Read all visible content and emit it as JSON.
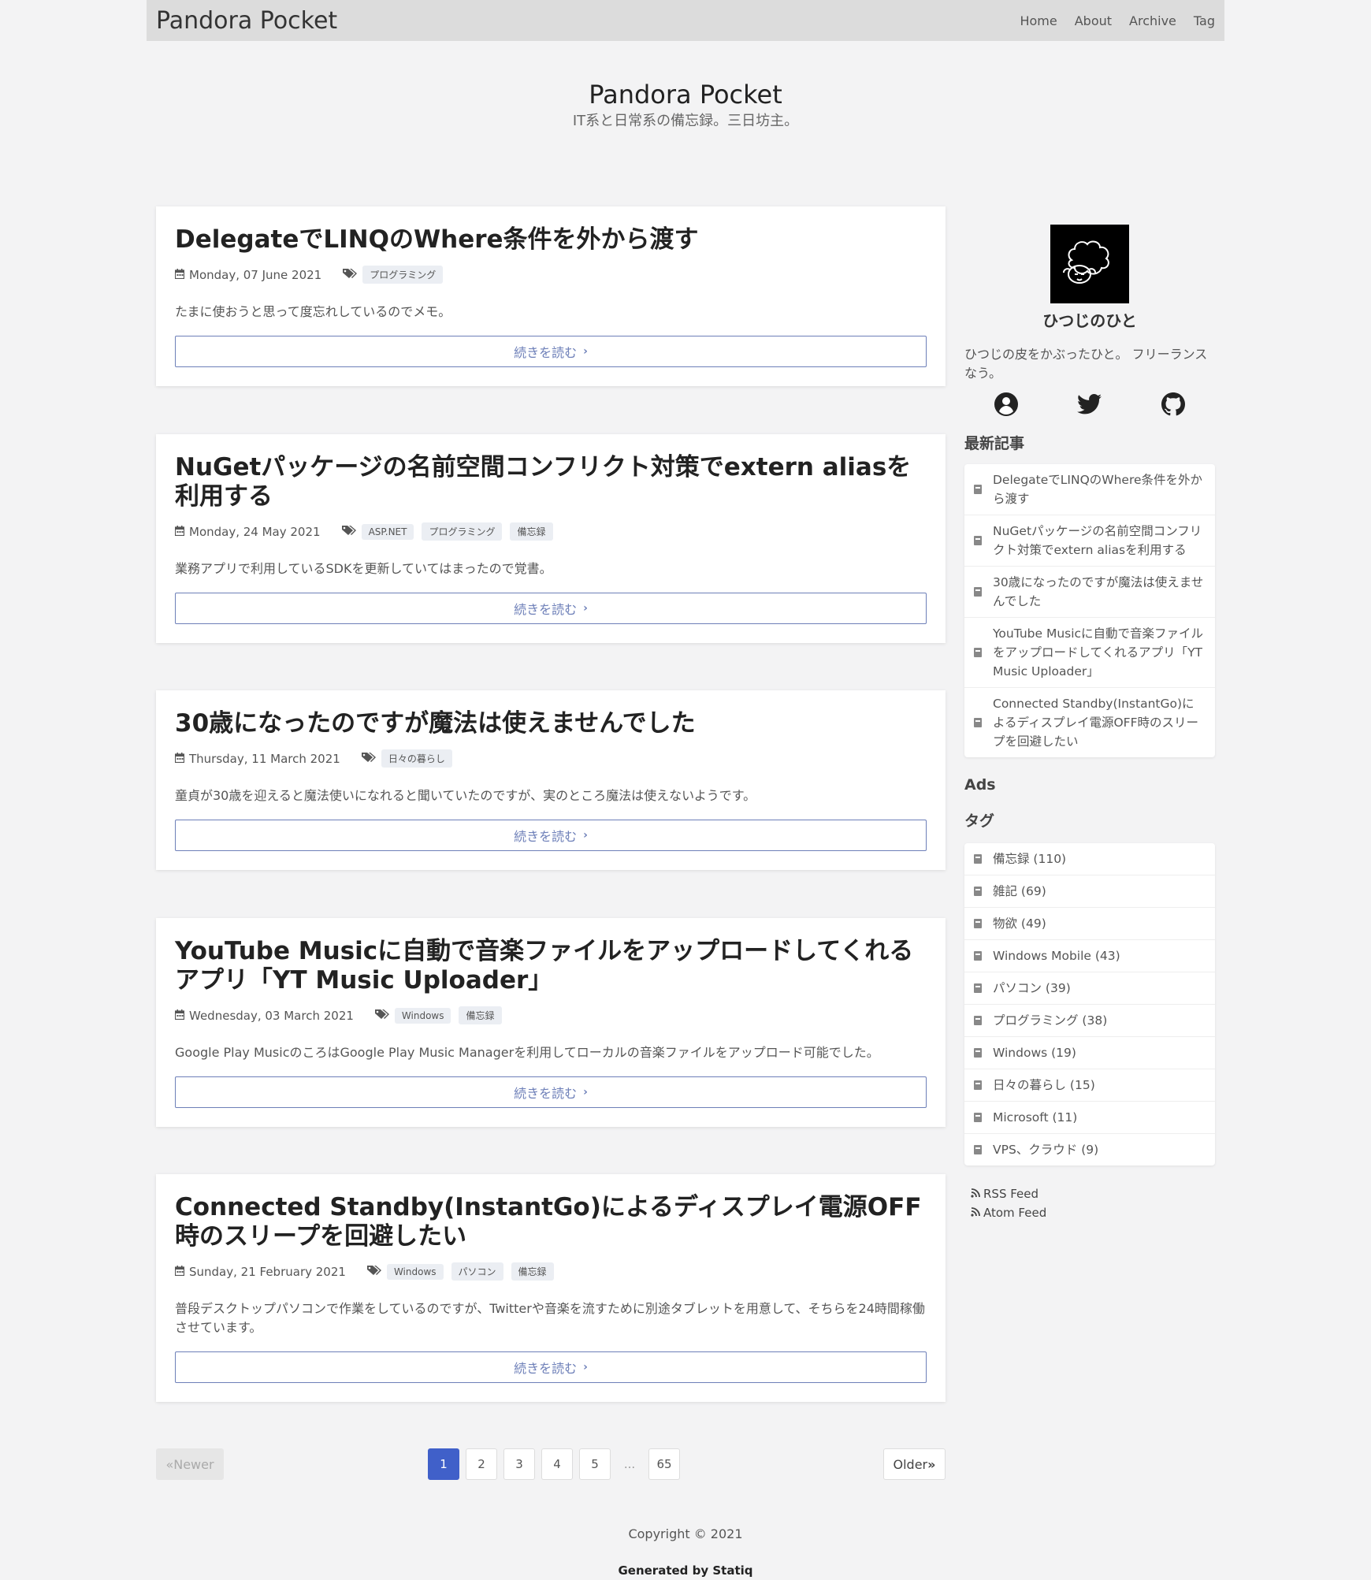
{
  "navbar": {
    "brand": "Pandora Pocket",
    "links": [
      "Home",
      "About",
      "Archive",
      "Tag"
    ]
  },
  "hero": {
    "title": "Pandora Pocket",
    "subtitle": "IT系と日常系の備忘録。三日坊主。"
  },
  "read_more_label": "続きを読む",
  "posts": [
    {
      "title": "DelegateでLINQのWhere条件を外から渡す",
      "date": "Monday, 07 June 2021",
      "tags": [
        "プログラミング"
      ],
      "excerpt": "たまに使おうと思って度忘れしているのでメモ。"
    },
    {
      "title": "NuGetパッケージの名前空間コンフリクト対策でextern aliasを利用する",
      "date": "Monday, 24 May 2021",
      "tags": [
        "ASP.NET",
        "プログラミング",
        "備忘録"
      ],
      "excerpt": "業務アプリで利用しているSDKを更新していてはまったので覚書。"
    },
    {
      "title": "30歳になったのですが魔法は使えませんでした",
      "date": "Thursday, 11 March 2021",
      "tags": [
        "日々の暮らし"
      ],
      "excerpt": "童貞が30歳を迎えると魔法使いになれると聞いていたのですが、実のところ魔法は使えないようです。"
    },
    {
      "title": "YouTube Musicに自動で音楽ファイルをアップロードしてくれるアプリ「YT Music Uploader」",
      "date": "Wednesday, 03 March 2021",
      "tags": [
        "Windows",
        "備忘録"
      ],
      "excerpt": "Google Play MusicのころはGoogle Play Music Managerを利用してローカルの音楽ファイルをアップロード可能でした。"
    },
    {
      "title": "Connected Standby(InstantGo)によるディスプレイ電源OFF時のスリープを回避したい",
      "date": "Sunday, 21 February 2021",
      "tags": [
        "Windows",
        "パソコン",
        "備忘録"
      ],
      "excerpt": "普段デスクトップパソコンで作業をしているのですが、Twitterや音楽を流すために別途タブレットを用意して、そちらを24時間稼働させています。"
    }
  ],
  "pager": {
    "newer": "Newer",
    "older": "Older",
    "pages": [
      "1",
      "2",
      "3",
      "4",
      "5",
      "...",
      "65"
    ],
    "current": "1"
  },
  "footer": {
    "copyright": "Copyright © 2021",
    "generated": "Generated by Statiq"
  },
  "sidebar": {
    "author_name": "ひつじのひと",
    "author_bio": "ひつじの皮をかぶったひと。 フリーランスなう。",
    "social_icons": [
      "user-circle-icon",
      "twitter-icon",
      "github-icon"
    ],
    "recent_heading": "最新記事",
    "recent_posts": [
      "DelegateでLINQのWhere条件を外から渡す",
      "NuGetパッケージの名前空間コンフリクト対策でextern aliasを利用する",
      "30歳になったのですが魔法は使えませんでした",
      "YouTube Musicに自動で音楽ファイルをアップロードしてくれるアプリ「YT Music Uploader」",
      "Connected Standby(InstantGo)によるディスプレイ電源OFF時のスリープを回避したい"
    ],
    "ads_heading": "Ads",
    "tags_heading": "タグ",
    "tags": [
      "備忘録 (110)",
      "雑記 (69)",
      "物欲 (49)",
      "Windows Mobile (43)",
      "パソコン (39)",
      "プログラミング (38)",
      "Windows (19)",
      "日々の暮らし (15)",
      "Microsoft (11)",
      "VPS、クラウド (9)"
    ],
    "feeds": [
      "RSS Feed",
      "Atom Feed"
    ]
  },
  "colors": {
    "accent": "#4060c9",
    "read_more": "#6d7fb8",
    "navbar_bg": "#dcdcdc",
    "page_bg": "#f3f3f4"
  }
}
